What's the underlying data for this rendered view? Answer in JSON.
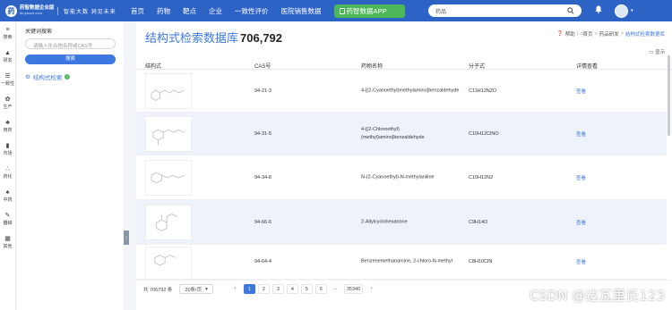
{
  "brand": {
    "mark": "药",
    "name": "药智数据企业版",
    "sub": "db.yaozh.com",
    "slogan": "智能大数 洞见未来"
  },
  "nav": [
    "首页",
    "药物",
    "靶点",
    "企业",
    "一致性评价",
    "医院销售数据"
  ],
  "app_button": "药智数据APP",
  "search": {
    "value": "药品"
  },
  "rail": [
    {
      "icon": "≡",
      "label": "搜索",
      "name": "search"
    },
    {
      "icon": "▲",
      "label": "研发",
      "name": "rd"
    },
    {
      "icon": "☰",
      "label": "一致性",
      "name": "consistency"
    },
    {
      "icon": "✿",
      "label": "生产",
      "name": "production"
    },
    {
      "icon": "♣",
      "label": "用药",
      "name": "medication"
    },
    {
      "icon": "▮",
      "label": "市场",
      "name": "market"
    },
    {
      "icon": "∴",
      "label": "药化",
      "name": "chem"
    },
    {
      "icon": "♠",
      "label": "中药",
      "name": "tcm"
    },
    {
      "icon": "✎",
      "label": "器械",
      "name": "device"
    },
    {
      "icon": "▦",
      "label": "其他",
      "name": "other"
    }
  ],
  "side": {
    "title": "关键词搜索",
    "placeholder": "请输入化合物名称或CAS号",
    "button": "搜索",
    "link": "结构式检索"
  },
  "page": {
    "title": "结构式检索数据库",
    "count": "706,792"
  },
  "breadcrumb": {
    "help": "帮助",
    "items": [
      "首页",
      "药品研发",
      "结构式检索数据库"
    ]
  },
  "display_label": "显示",
  "columns": [
    "结构式",
    "CAS号",
    "药物名称",
    "分子式",
    "详情查看"
  ],
  "rows": [
    {
      "cas": "94-21-3",
      "name": "4-[(2-Cyanoethyl)methylamino]benzaldehyde",
      "formula": "C11H12N2O",
      "view": "查看"
    },
    {
      "cas": "94-31-5",
      "name": "4-[(2-Chloroethyl)(methyl)amino]benzaldehyde",
      "formula": "C10H12ClNO",
      "view": "查看"
    },
    {
      "cas": "94-34-8",
      "name": "N-(2-Cyanoethyl)-N-methylaniline",
      "formula": "C10H12N2",
      "view": "查看"
    },
    {
      "cas": "94-66-6",
      "name": "2-Allylcyclohexanone",
      "formula": "C9H14O",
      "view": "查看"
    },
    {
      "cas": "94-64-4",
      "name": "Benzenemethanamine, 2-chloro-N-methyl",
      "formula": "C8H10ClN",
      "view": "查看"
    }
  ],
  "pagination": {
    "total": "共 706792 条",
    "per_page": "20条/页",
    "prev": "‹",
    "pages": [
      "1",
      "2",
      "3",
      "4",
      "5",
      "6",
      "...",
      "35340"
    ],
    "next": "›"
  },
  "watermark": "CSDN @达瓦里氏123"
}
